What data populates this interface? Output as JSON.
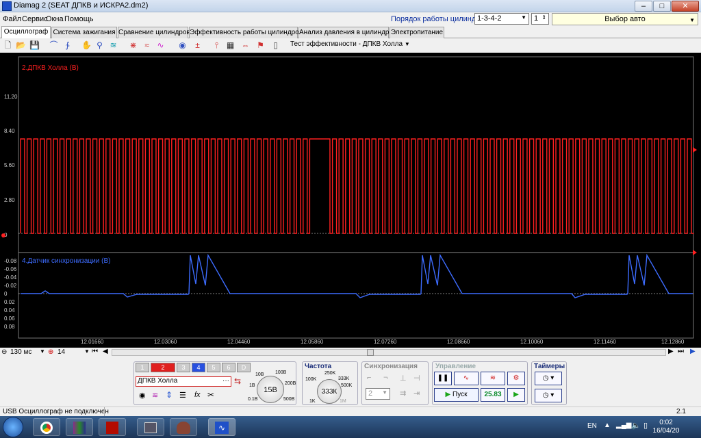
{
  "window": {
    "title": "Diamag 2 (SEAT ДПКВ и ИСКРА2.dm2)",
    "min": "‒",
    "max": "□",
    "close": "✕"
  },
  "menu": [
    "Файл",
    "Сервис",
    "Окна",
    "Помощь"
  ],
  "firing_order": {
    "label": "Порядок работы цилиндров",
    "value": "1-3-4-2",
    "cylinder": "1"
  },
  "auto_select": "Выбор авто",
  "tabs": [
    "Осциллограф",
    "Система зажигания",
    "Сравнение цилиндров",
    "Эффективность работы цилиндров",
    "Анализ давления в цилиндре",
    "Электропитание"
  ],
  "toolbar": {
    "effect_test": "Тест эффективности - ДПКВ Холла"
  },
  "channels": {
    "upper": {
      "label": "2.ДПКВ Холла (В)",
      "color": "#ff2020",
      "ticks": [
        "11.20",
        "8.40",
        "5.60",
        "2.80",
        "0"
      ]
    },
    "lower": {
      "label": "4.Датчик синхронизации (В)",
      "color": "#3d6cff",
      "ticks": [
        "-0.08",
        "-0.06",
        "-0.04",
        "-0.02",
        "0",
        "0.02",
        "0.04",
        "0.06",
        "0.08"
      ]
    }
  },
  "xaxis": {
    "ticks": [
      "12.01660",
      "12.03060",
      "12.04460",
      "12.05860",
      "12.07260",
      "12.08660",
      "12.10060",
      "12.11460",
      "12.12860"
    ]
  },
  "timebar": {
    "timebase": "130 мс",
    "frames": "14"
  },
  "controls": {
    "channel_buttons": [
      "1",
      "2",
      "3",
      "4",
      "5",
      "6",
      "D"
    ],
    "sensor_name": "ДПКВ Холла",
    "voltage": {
      "center": "15В",
      "marks": [
        "10В",
        "100В",
        "1В",
        "200В",
        "0.1В",
        "500В"
      ]
    },
    "frequency": {
      "title": "Частота",
      "center": "333К",
      "marks": [
        "250K",
        "100K",
        "333K",
        "500K",
        "1K",
        "1M"
      ]
    },
    "sync": {
      "title": "Синхронизация",
      "value": "2"
    },
    "control": {
      "title": "Управление",
      "start": "Пуск",
      "readout": "25.83"
    },
    "timers": {
      "title": "Таймеры"
    }
  },
  "status": {
    "left": "USB Осциллограф не подключен",
    "right": "2.1"
  },
  "tray": {
    "lang": "EN",
    "time": "0:02",
    "date": "16/04/20"
  }
}
